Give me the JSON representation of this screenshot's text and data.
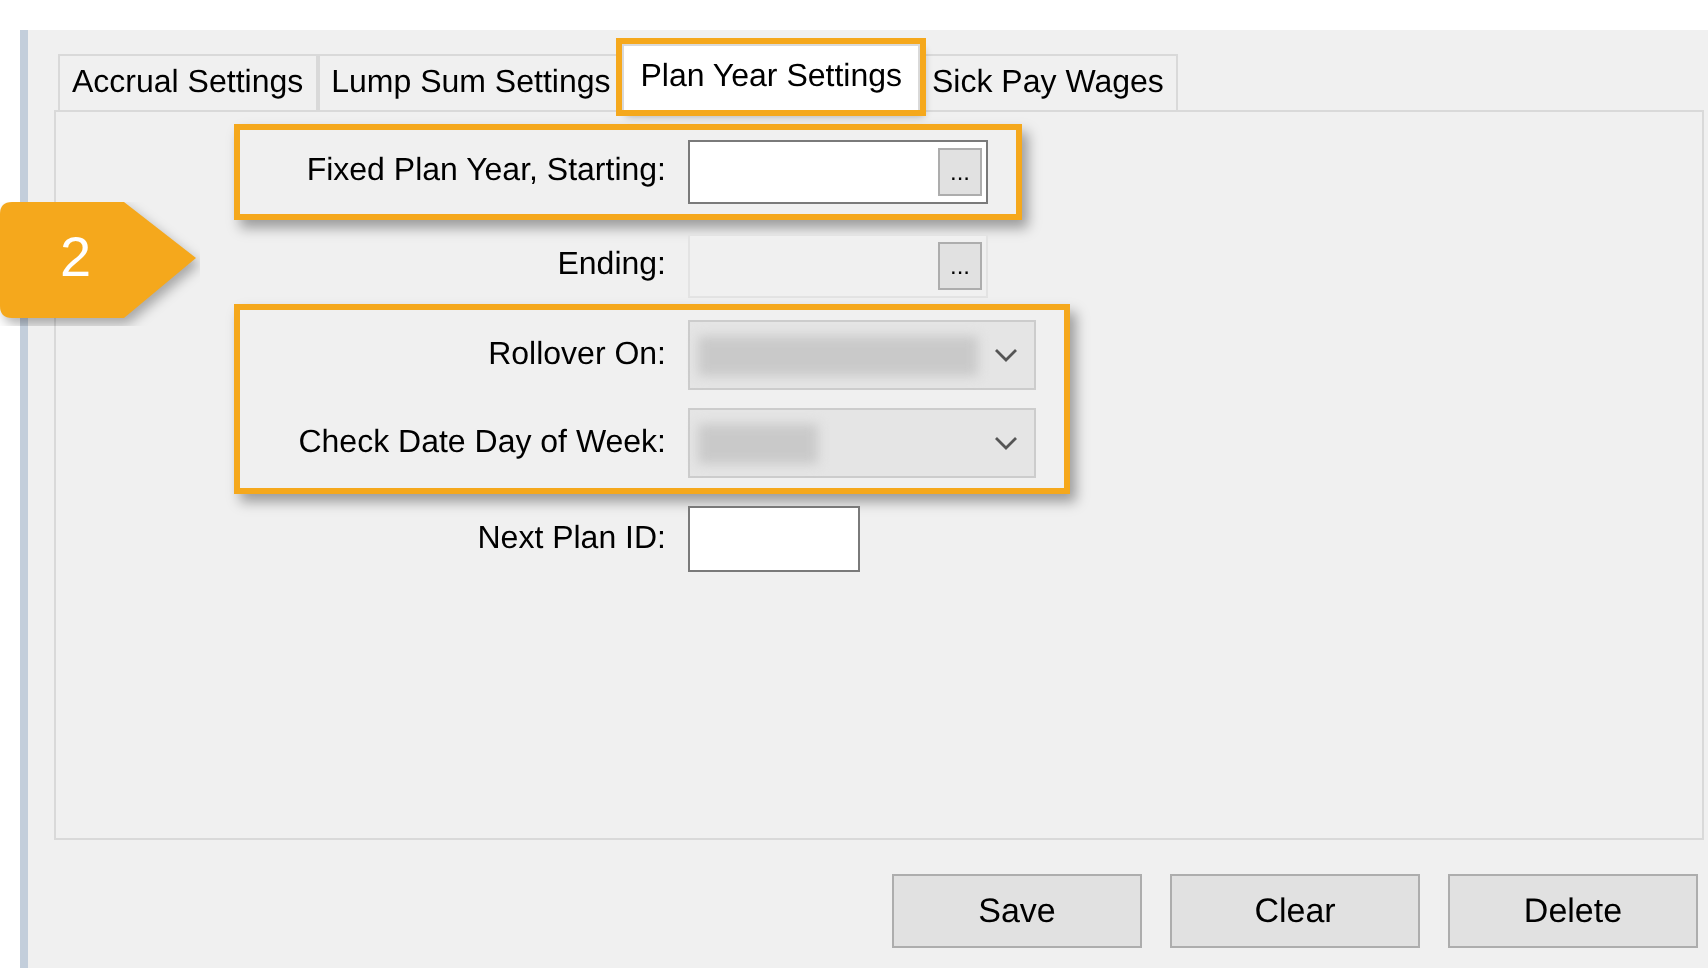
{
  "tabs": [
    {
      "label": "Accrual Settings",
      "selected": false,
      "highlighted": false
    },
    {
      "label": "Lump Sum Settings",
      "selected": false,
      "highlighted": false
    },
    {
      "label": "Plan Year Settings",
      "selected": true,
      "highlighted": true
    },
    {
      "label": "Sick Pay Wages",
      "selected": false,
      "highlighted": false
    }
  ],
  "callout": {
    "label": "2"
  },
  "groups": [
    {
      "highlighted": true,
      "fields": [
        {
          "kind": "date",
          "label": "Fixed Plan Year, Starting:",
          "button": "...",
          "disabled": false
        }
      ]
    },
    {
      "highlighted": false,
      "fields": [
        {
          "kind": "date",
          "label": "Ending:",
          "button": "...",
          "disabled": true
        }
      ]
    },
    {
      "highlighted": true,
      "fields": [
        {
          "kind": "dropdown",
          "label": "Rollover On:",
          "redacted": true
        },
        {
          "kind": "dropdown",
          "label": "Check Date Day of Week:",
          "redacted": true
        }
      ]
    },
    {
      "highlighted": false,
      "fields": [
        {
          "kind": "text",
          "label": "Next Plan ID:"
        }
      ]
    }
  ],
  "buttons": [
    "Save",
    "Clear",
    "Delete"
  ]
}
